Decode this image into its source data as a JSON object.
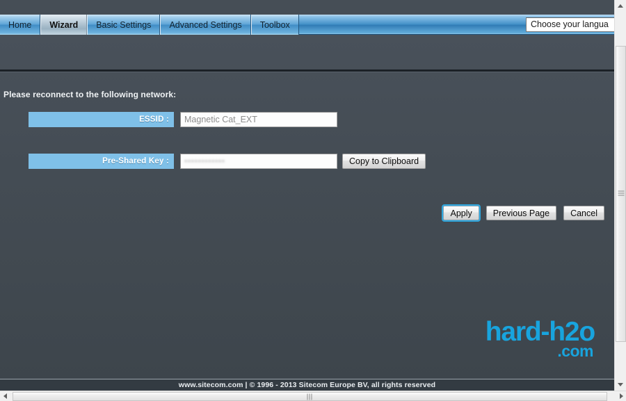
{
  "nav": {
    "tabs": [
      {
        "label": "Home",
        "active": false
      },
      {
        "label": "Wizard",
        "active": true
      },
      {
        "label": "Basic Settings",
        "active": false
      },
      {
        "label": "Advanced Settings",
        "active": false
      },
      {
        "label": "Toolbox",
        "active": false
      }
    ],
    "language_select": {
      "value": "Choose your language",
      "visible_text": "Choose your langua"
    }
  },
  "main": {
    "instruction": "Please reconnect to the following network:",
    "fields": [
      {
        "label": "ESSID :",
        "value": "Magnetic Cat_EXT",
        "masked": false
      },
      {
        "label": "Pre-Shared Key :",
        "value": "••••••••••••",
        "masked": true
      }
    ],
    "copy_button": "Copy to Clipboard",
    "actions": [
      {
        "label": "Apply",
        "focused": true
      },
      {
        "label": "Previous Page",
        "focused": false
      },
      {
        "label": "Cancel",
        "focused": false
      }
    ]
  },
  "watermark": {
    "line1": "hard-h2o",
    "line2": ".com",
    "color": "#18a4de"
  },
  "footer": {
    "text": "www.sitecom.com | © 1996 - 2013 Sitecom Europe BV, all rights reserved"
  },
  "colors": {
    "nav_blue": "#3f8ec6",
    "label_blue": "#7fc0e8",
    "page_bg": "#444c54",
    "footer_bg": "#333b42",
    "focus_ring": "#2fa8e0"
  }
}
